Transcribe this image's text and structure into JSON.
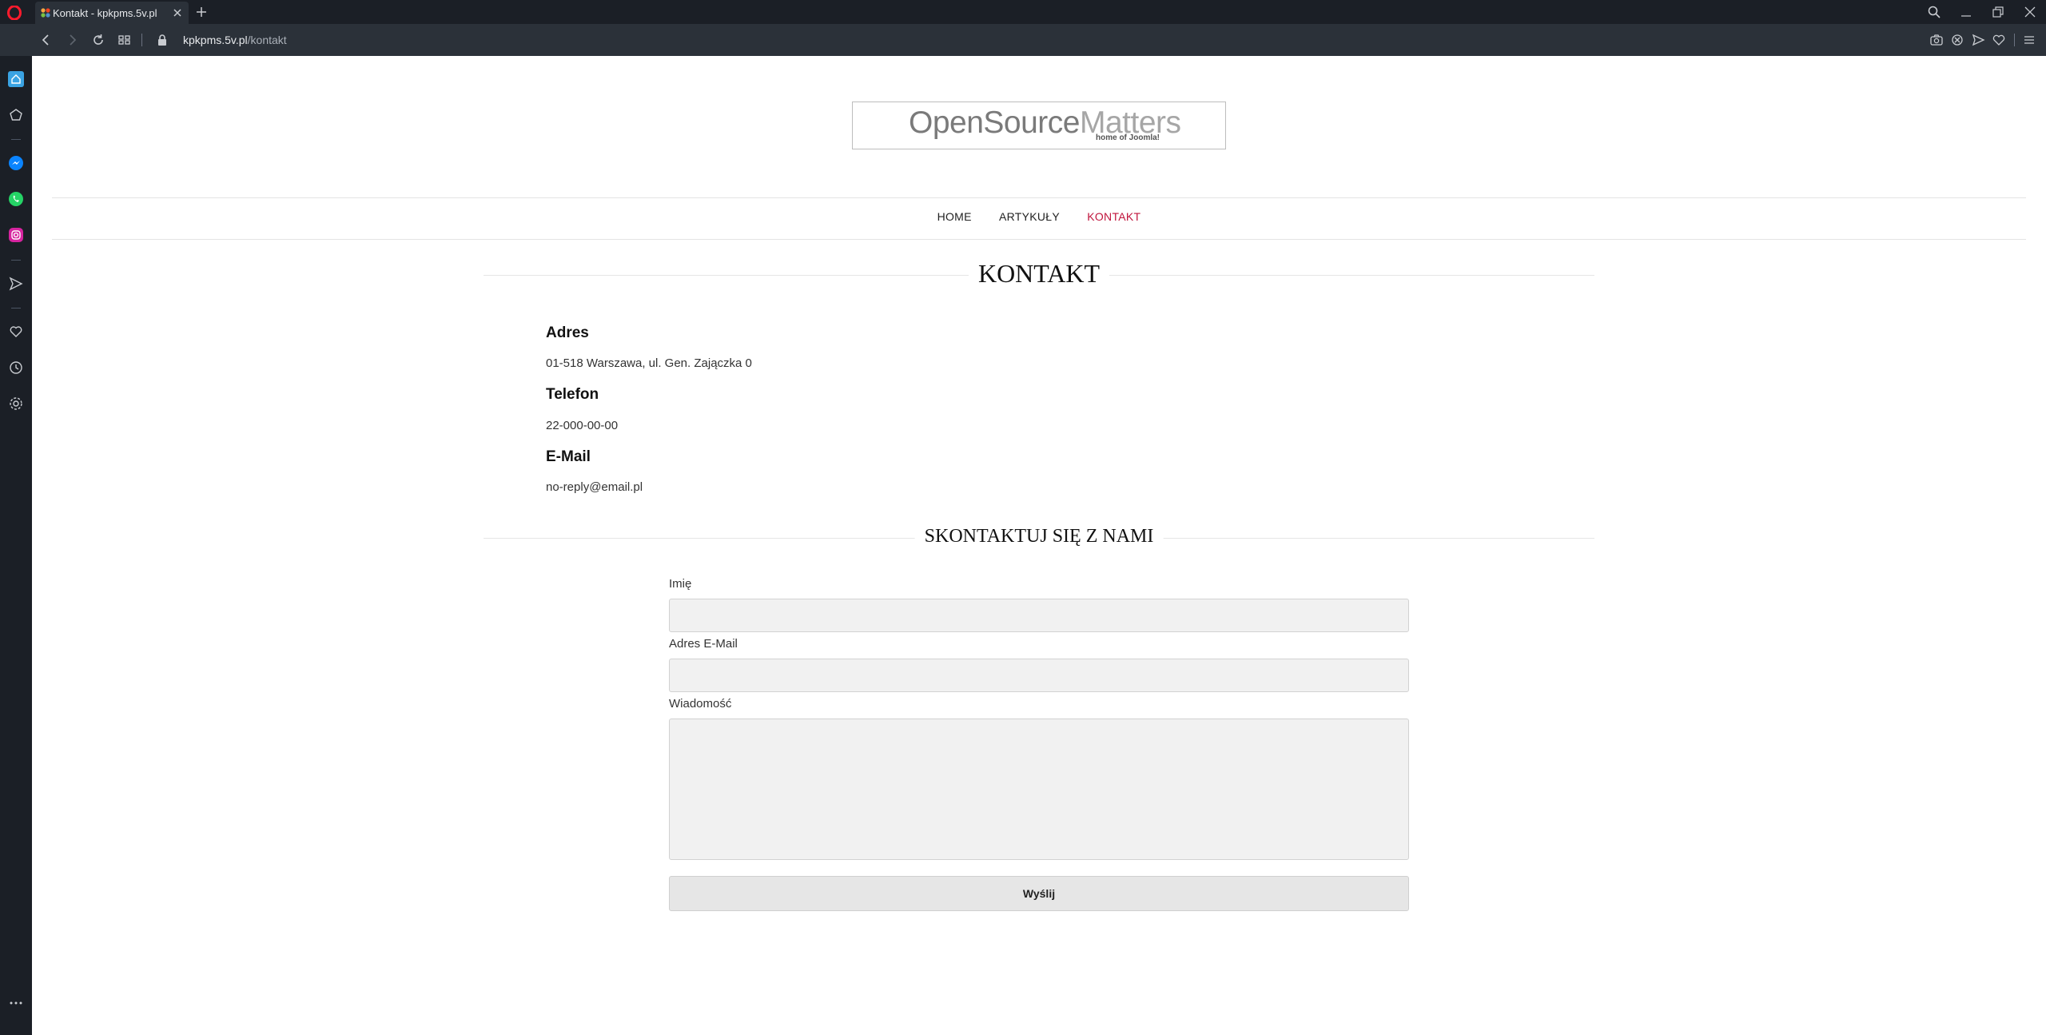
{
  "browser": {
    "tab_title": "Kontakt - kpkpms.5v.pl",
    "url_host": "kpkpms.5v.pl",
    "url_path": "/kontakt"
  },
  "site": {
    "logo_text_a": "OpenSource",
    "logo_text_b": "Matters",
    "logo_sub": "home of Joomla!",
    "menu": [
      {
        "label": "HOME",
        "active": false
      },
      {
        "label": "ARTYKUŁY",
        "active": false
      },
      {
        "label": "KONTAKT",
        "active": true
      }
    ],
    "accent_color": "#c0143c"
  },
  "contact": {
    "title": "KONTAKT",
    "items": [
      {
        "heading": "Adres",
        "value": "01-518 Warszawa, ul. Gen. Zajączka 0"
      },
      {
        "heading": "Telefon",
        "value": "22-000-00-00"
      },
      {
        "heading": "E-Mail",
        "value": "no-reply@email.pl"
      }
    ]
  },
  "form": {
    "title": "SKONTAKTUJ SIĘ Z NAMI",
    "name_label": "Imię",
    "name_value": "",
    "email_label": "Adres E-Mail",
    "email_value": "",
    "message_label": "Wiadomość",
    "message_value": "",
    "submit_label": "Wyślij"
  }
}
